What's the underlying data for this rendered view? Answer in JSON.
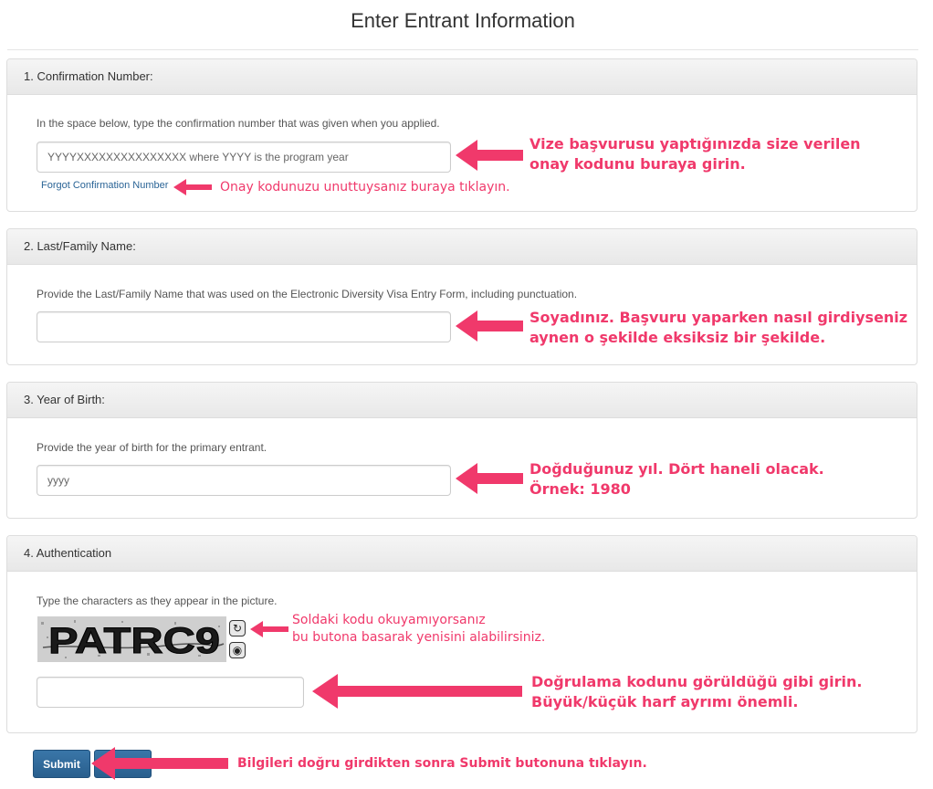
{
  "page": {
    "title": "Enter Entrant Information"
  },
  "sections": {
    "confirmation": {
      "heading": "1. Confirmation Number:",
      "instruction": "In the space below, type the confirmation number that was given when you applied.",
      "input_placeholder": "YYYYXXXXXXXXXXXXXXX where YYYY is the program year",
      "forgot_link": "Forgot Confirmation Number"
    },
    "last_name": {
      "heading": "2. Last/Family Name:",
      "instruction": "Provide the Last/Family Name that was used on the Electronic Diversity Visa Entry Form, including punctuation.",
      "input_placeholder": ""
    },
    "birth_year": {
      "heading": "3. Year of Birth:",
      "instruction": "Provide the year of birth for the primary entrant.",
      "input_placeholder": "yyyy"
    },
    "authentication": {
      "heading": "4. Authentication",
      "instruction": "Type the characters as they appear in the picture.",
      "captcha_text": "PATRC9",
      "input_placeholder": ""
    }
  },
  "buttons": {
    "submit": "Submit",
    "second": ""
  },
  "annotations": {
    "confirmation_line1": "Vize başvurusu yaptığınızda size verilen",
    "confirmation_line2": "onay kodunu buraya girin.",
    "forgot": "Onay kodunuzu unuttuysanız buraya tıklayın.",
    "lastname_line1": "Soyadınız. Başvuru yaparken nasıl girdiyseniz",
    "lastname_line2": "aynen o şekilde eksiksiz bir şekilde.",
    "birth_line1": "Doğduğunuz yıl. Dört haneli olacak.",
    "birth_line2": "Örnek: 1980",
    "captcha_line1": "Soldaki kodu okuyamıyorsanız",
    "captcha_line2": "bu butona basarak yenisini alabilirsiniz.",
    "auth_line1": "Doğrulama kodunu görüldüğü gibi girin.",
    "auth_line2": "Büyük/küçük harf ayrımı önemli.",
    "submit": "Bilgileri doğru girdikten sonra Submit butonuna tıklayın."
  },
  "colors": {
    "annotation": "#f0396b",
    "link": "#2a6496",
    "button": "#2e6a9c"
  },
  "icons": {
    "refresh": "refresh-icon",
    "audio": "audio-icon",
    "arrow": "left-arrow-icon"
  }
}
